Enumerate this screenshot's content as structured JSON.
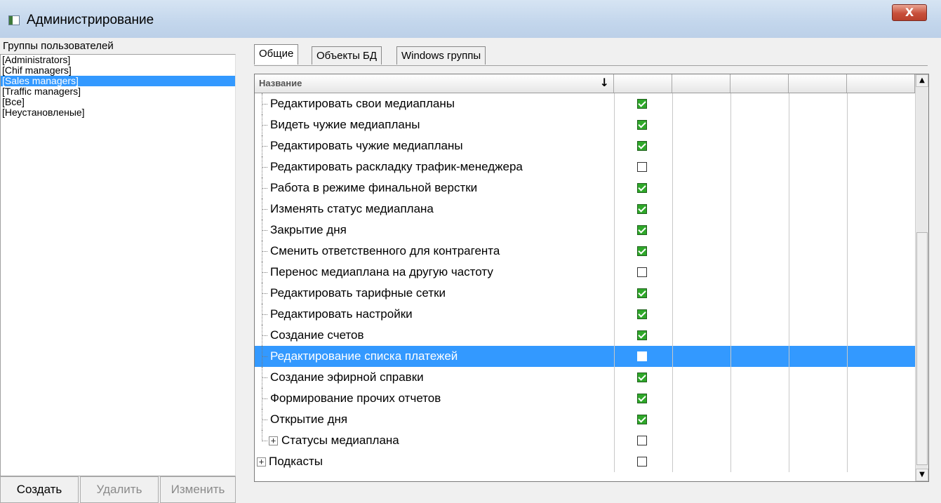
{
  "window": {
    "title": "Администрирование",
    "close_glyph": "X"
  },
  "left_panel": {
    "header": "Группы пользователей",
    "groups": [
      {
        "label": "[Administrators]",
        "selected": false
      },
      {
        "label": "[Chif managers]",
        "selected": false
      },
      {
        "label": "[Sales managers]",
        "selected": true
      },
      {
        "label": "[Traffic managers]",
        "selected": false
      },
      {
        "label": "[Все]",
        "selected": false
      },
      {
        "label": "[Неустановленые]",
        "selected": false
      }
    ],
    "buttons": {
      "create": "Создать",
      "delete": "Удалить",
      "edit": "Изменить"
    }
  },
  "tabs": [
    {
      "label": "Общие",
      "active": true
    },
    {
      "label": "Объекты БД",
      "active": false
    },
    {
      "label": "Windows группы",
      "active": false
    }
  ],
  "grid": {
    "column_header": "Название",
    "sort_glyph": "↓",
    "rows": [
      {
        "label": "Редактировать свои медиапланы",
        "checked": true,
        "selected": false
      },
      {
        "label": "Видеть чужие медиапланы",
        "checked": true,
        "selected": false
      },
      {
        "label": "Редактировать чужие медиапланы",
        "checked": true,
        "selected": false
      },
      {
        "label": "Редактировать раскладку трафик-менеджера",
        "checked": false,
        "selected": false
      },
      {
        "label": "Работа в режиме финальной верстки",
        "checked": true,
        "selected": false
      },
      {
        "label": "Изменять статус медиаплана",
        "checked": true,
        "selected": false
      },
      {
        "label": "Закрытие дня",
        "checked": true,
        "selected": false
      },
      {
        "label": "Сменить ответственного для контрагента",
        "checked": true,
        "selected": false
      },
      {
        "label": "Перенос медиаплана на другую частоту",
        "checked": false,
        "selected": false
      },
      {
        "label": "Редактировать тарифные сетки",
        "checked": true,
        "selected": false
      },
      {
        "label": "Редактировать настройки",
        "checked": true,
        "selected": false
      },
      {
        "label": "Создание счетов",
        "checked": true,
        "selected": false
      },
      {
        "label": "Редактирование списка платежей",
        "checked": false,
        "selected": true
      },
      {
        "label": "Создание эфирной справки",
        "checked": true,
        "selected": false
      },
      {
        "label": "Формирование прочих отчетов",
        "checked": true,
        "selected": false
      },
      {
        "label": "Открытие дня",
        "checked": true,
        "selected": false
      },
      {
        "label": "Статусы медиаплана",
        "checked": false,
        "selected": false,
        "expandable": true,
        "last_child": true
      },
      {
        "label": "Подкасты",
        "checked": false,
        "selected": false,
        "expandable": true,
        "root": true
      }
    ],
    "expander_glyph": "+",
    "scroll_up": "▲",
    "scroll_down": "▼"
  }
}
